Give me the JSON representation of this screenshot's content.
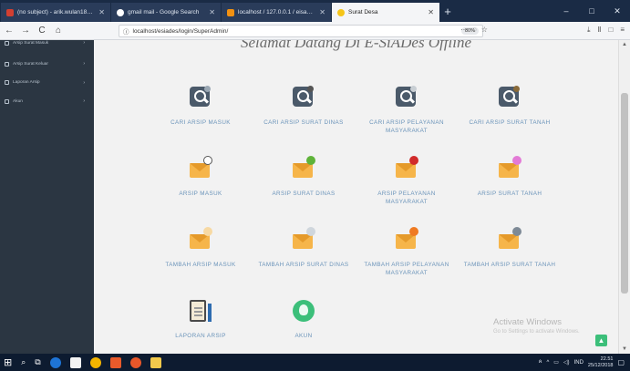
{
  "browser": {
    "tabs": [
      {
        "title": "(no subject) - arik.wulan18@g",
        "favicon_color": "#d23f31",
        "active": false
      },
      {
        "title": "gmail mail - Google Search",
        "favicon_color": "#ffffff",
        "active": false
      },
      {
        "title": "localhost / 127.0.0.1 / eisades",
        "favicon_color": "#f29111",
        "active": false
      },
      {
        "title": "Surat Desa",
        "favicon_color": "#f5c518",
        "active": true
      }
    ],
    "new_tab": "+",
    "window_controls": [
      "–",
      "□",
      "✕"
    ],
    "nav": {
      "back": "←",
      "forward": "→",
      "reload": "C",
      "home": "⌂"
    },
    "url": "localhost/esiades/login/SuperAdmin/",
    "zoom": "80%",
    "url_icons": [
      "···",
      "◌",
      "☆"
    ],
    "right_icons": [
      "⤓",
      "Ⅱ",
      "□",
      "≡"
    ]
  },
  "sidebar": {
    "items": [
      {
        "label": "Arsip Surat Masuk"
      },
      {
        "label": "Arsip Surat Keluar"
      },
      {
        "label": "Laporan Arsip"
      },
      {
        "label": "Akun"
      }
    ]
  },
  "main": {
    "heading": "Selamat Datang Di E-SiADes Offline",
    "tiles": [
      {
        "label": "CARI ARSIP MASUK",
        "icon": "search-icon",
        "accent": "#9aa7b3"
      },
      {
        "label": "CARI ARSIP SURAT DINAS",
        "icon": "search-icon",
        "accent": "#555555"
      },
      {
        "label": "CARI ARSIP PELAYANAN MASYARAKAT",
        "icon": "search-icon",
        "accent": "#c9cfd4"
      },
      {
        "label": "CARI ARSIP SURAT TANAH",
        "icon": "search-icon",
        "accent": "#8a6b3a"
      },
      {
        "label": "ARSIP MASUK",
        "icon": "envelope-icon",
        "accent": "#ffffff"
      },
      {
        "label": "ARSIP SURAT DINAS",
        "icon": "envelope-icon",
        "accent": "#5fb33a"
      },
      {
        "label": "ARSIP PELAYANAN MASYARAKAT",
        "icon": "envelope-icon",
        "accent": "#d12b2b"
      },
      {
        "label": "ARSIP SURAT TANAH",
        "icon": "envelope-icon",
        "accent": "#e37ad6"
      },
      {
        "label": "TAMBAH ARSIP MASUK",
        "icon": "envelope-icon",
        "accent": "#f7d9a3"
      },
      {
        "label": "TAMBAH ARSIP SURAT DINAS",
        "icon": "envelope-icon",
        "accent": "#cfd6dc"
      },
      {
        "label": "TAMBAH ARSIP PELAYANAN MASYARAKAT",
        "icon": "envelope-icon",
        "accent": "#ef7a22"
      },
      {
        "label": "TAMBAH ARSIP SURAT TANAH",
        "icon": "envelope-icon",
        "accent": "#7e8a96"
      },
      {
        "label": "LAPORAN ARSIP",
        "icon": "clipboard-icon",
        "accent": "#2e6cb0"
      },
      {
        "label": "AKUN",
        "icon": "users-icon",
        "accent": "#3cbf7a"
      }
    ]
  },
  "watermark": {
    "line1": "Activate Windows",
    "line2": "Go to Settings to activate Windows."
  },
  "taskbar": {
    "tray_lang": "IND",
    "time": "22.51",
    "date": "25/12/2018"
  }
}
